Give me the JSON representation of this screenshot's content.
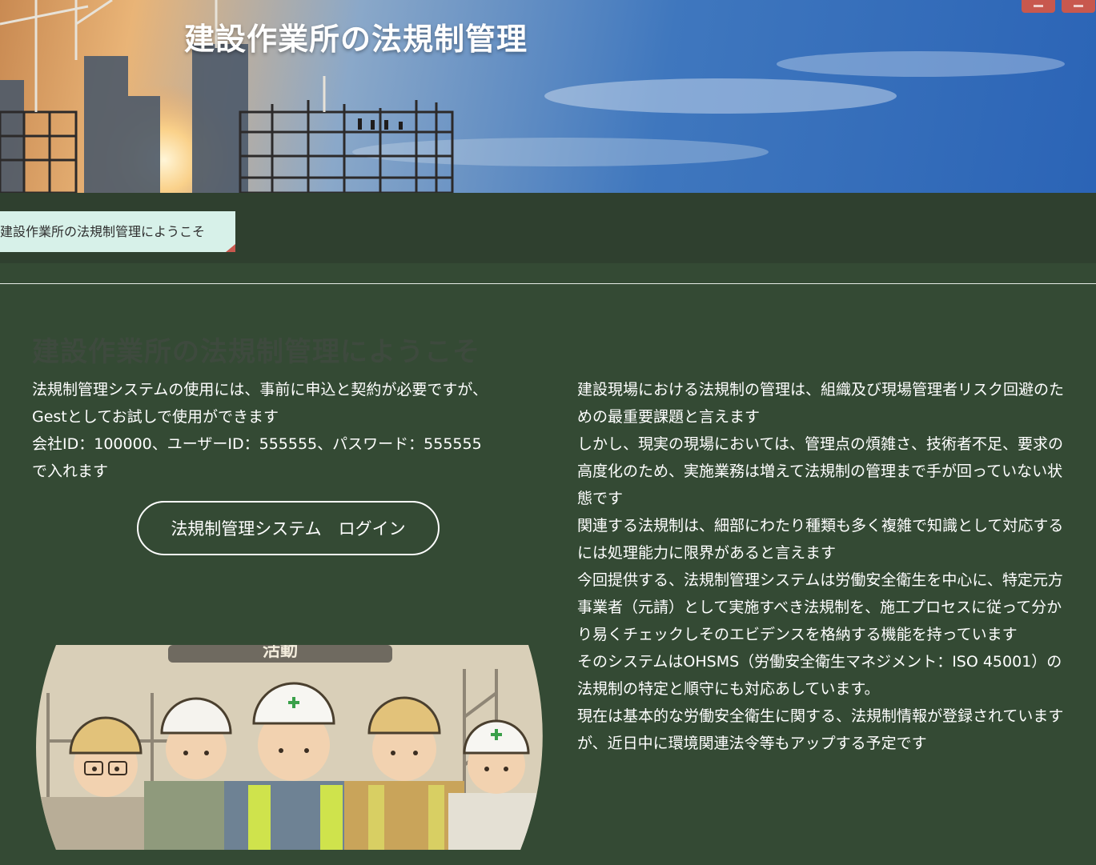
{
  "hero": {
    "title": "建設作業所の法規制管理"
  },
  "tabs": [
    {
      "label": "建設作業所の法規制管理にようこそ"
    }
  ],
  "content": {
    "heading": "建設作業所の法規制管理にようこそ",
    "left_lines": [
      "法規制管理システムの使用には、事前に申込と契約が必要ですが、",
      "Gestとしてお試しで使用ができます",
      "会社ID：100000、ユーザーID：555555、パスワード：555555",
      "で入れます"
    ],
    "login_label": "法規制管理システム　ログイン",
    "right_lines": [
      "建設現場における法規制の管理は、組織及び現場管理者リスク回避のた",
      "めの最重要課題と言えます",
      "しかし、現実の現場においては、管理点の煩雑さ、技術者不足、要求の",
      "高度化のため、実施業務は増えて法規制の管理まで手が回っていない状",
      "態です",
      "関連する法規制は、細部にわたり種類も多く複雑で知識として対応する",
      "には処理能力に限界があると言えます",
      "今回提供する、法規制管理システムは労働安全衛生を中心に、特定元方",
      "事業者（元請）として実施すべき法規制を、施工プロセスに従って分か",
      "り易くチェックしそのエビデンスを格納する機能を持っています",
      "そのシステムはOHSMS（労働安全衛生マネジメント：ISO 45001）の",
      "法規制の特定と順守にも対応あしています。",
      "現在は基本的な労働安全衛生に関する、法規制情報が登録されています",
      "が、近日中に環境関連法令等もアップする予定です"
    ],
    "sign_text": "活動"
  },
  "colors": {
    "page_bg": "#344a34",
    "tabbar_bg": "#2f402f",
    "tab_bg": "#d7f1e9",
    "accent_red": "#c8584e"
  }
}
